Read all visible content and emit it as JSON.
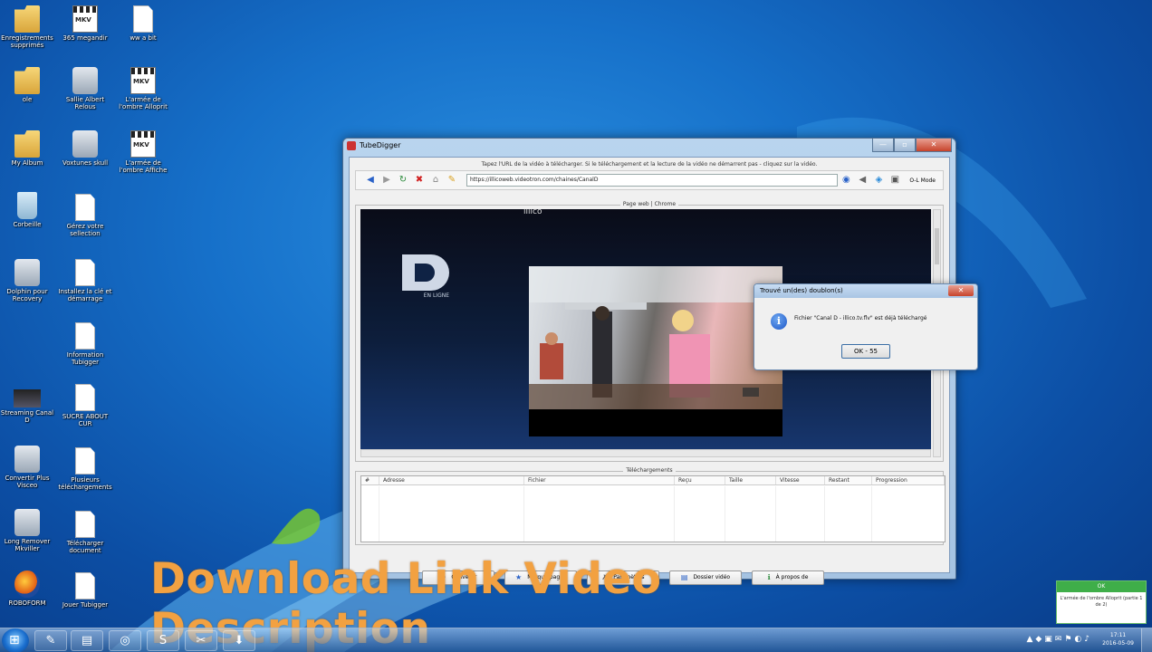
{
  "desktop": {
    "icons": [
      {
        "label": "Enregistrements supprimés",
        "kind": "folder"
      },
      {
        "label": "365 megandir",
        "kind": "mkv"
      },
      {
        "label": "ww a bit",
        "kind": "doc"
      },
      {
        "label": "ole",
        "kind": "folder"
      },
      {
        "label": "Sallie Albert Relous",
        "kind": "app"
      },
      {
        "label": "L'armée de l'ombre Alloprit",
        "kind": "mkv"
      },
      {
        "label": "My Album",
        "kind": "folder"
      },
      {
        "label": "Voxtunes skull",
        "kind": "app"
      },
      {
        "label": "L'armée de l'ombre Affiche",
        "kind": "mkv"
      },
      {
        "label": "Corbeille",
        "kind": "bin"
      },
      {
        "label": "Gérez votre sellection",
        "kind": "doc"
      },
      {
        "label": "Dolphin pour Recovery",
        "kind": "app"
      },
      {
        "label": "Installez la clé et démarrage",
        "kind": "doc"
      },
      {
        "label": "Information Tubigger",
        "kind": "doc"
      },
      {
        "label": "Streaming Canal D",
        "kind": "thumb"
      },
      {
        "label": "SUCRE ABOUT CUR",
        "kind": "doc"
      },
      {
        "label": "Convertir Plus Visceo",
        "kind": "app"
      },
      {
        "label": "Plusieurs téléchargements",
        "kind": "doc"
      },
      {
        "label": "Long Remover Mkviller",
        "kind": "app"
      },
      {
        "label": "Télécharger document",
        "kind": "doc"
      },
      {
        "label": "ROBOFORM",
        "kind": "ff"
      },
      {
        "label": "Jouer Tubigger",
        "kind": "doc"
      }
    ]
  },
  "window": {
    "title": "TubeDigger",
    "controls": {
      "minimize": "—",
      "maximize": "▫",
      "close": "✕"
    },
    "instructions": "Tapez l'URL de la vidéo à télécharger. Si le téléchargement et la lecture de la vidéo ne démarrent pas - cliquez sur la vidéo.",
    "url": "https://illicoweb.videotron.com/chaines/CanalD",
    "ol_mode": "O-L Mode",
    "web_group_label": "Page web | Chrome",
    "brand_top": "illico",
    "logo_sub": "EN LIGNE",
    "downloads_label": "Téléchargements",
    "columns": [
      "#",
      "Adresse",
      "Fichier",
      "Reçu",
      "Taille",
      "Vitesse",
      "Restant",
      "Progression"
    ],
    "buttons": [
      {
        "label": "Convertir",
        "icon": "convert-icon",
        "glyph": "↻"
      },
      {
        "label": "Marque-pages",
        "icon": "star-icon",
        "glyph": "★"
      },
      {
        "label": "Paramètres",
        "icon": "tools-icon",
        "glyph": "✗"
      },
      {
        "label": "Dossier vidéo",
        "icon": "folder-icon",
        "glyph": "▤"
      },
      {
        "label": "À propos de",
        "icon": "info-icon",
        "glyph": "ℹ"
      }
    ]
  },
  "dialog": {
    "title": "Trouvé un(des) doublon(s)",
    "close": "✕",
    "message": "Fichier \"Canal D - illico.tv.flv\" est déjà téléchargé",
    "ok": "OK - 55"
  },
  "overlay_text": "Download Link Video Description",
  "notification": {
    "header": "OK",
    "body": "L'armée de l'ombre Alloprit (partie 1 de 2)"
  },
  "taskbar": {
    "time": "17:11",
    "date": "2016-05-09"
  },
  "colors": {
    "overlay": "#f2a141",
    "accent": "#1670c9"
  }
}
